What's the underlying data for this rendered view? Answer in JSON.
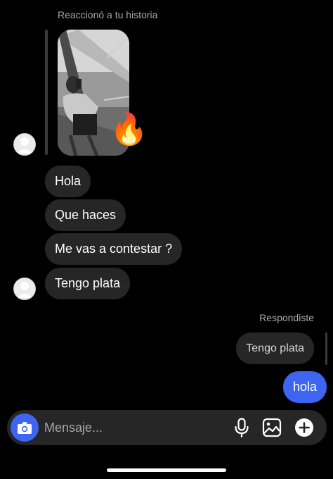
{
  "story": {
    "caption": "Reaccionó a tu historia",
    "reaction_emoji": "🔥",
    "thumbnail_icon": "mirror-selfie-photo"
  },
  "incoming_messages": [
    {
      "text": "Hola"
    },
    {
      "text": "Que haces"
    },
    {
      "text": "Me vas a contestar ?"
    },
    {
      "text": "Tengo plata"
    }
  ],
  "reply": {
    "caption": "Respondiste",
    "quoted_text": "Tengo plata"
  },
  "outgoing_messages": [
    {
      "text": "hola"
    }
  ],
  "composer": {
    "placeholder": "Mensaje...",
    "icons": [
      "camera-icon",
      "microphone-icon",
      "image-gallery-icon",
      "plus-icon"
    ]
  },
  "colors": {
    "background": "#000000",
    "incoming_bubble": "#262626",
    "outgoing_bubble": "#3d65f2",
    "muted_text": "#a8a8a8"
  }
}
